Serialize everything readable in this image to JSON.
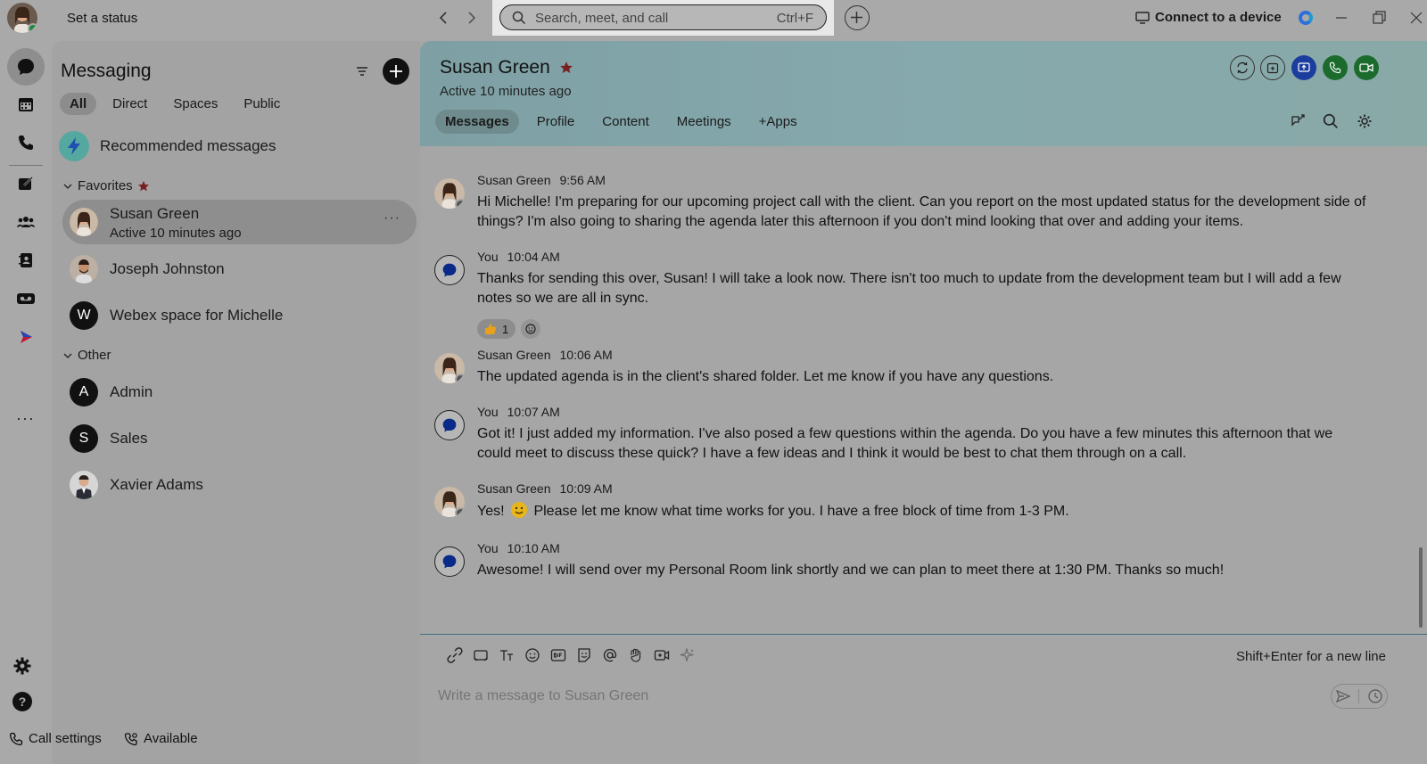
{
  "titlebar": {
    "set_status": "Set a status",
    "search_placeholder": "Search, meet, and call",
    "search_shortcut": "Ctrl+F",
    "connect_device": "Connect to a device"
  },
  "messaging": {
    "title": "Messaging",
    "tabs": [
      "All",
      "Direct",
      "Spaces",
      "Public"
    ],
    "recommended": "Recommended messages",
    "favorites_label": "Favorites",
    "other_label": "Other",
    "favorites": [
      {
        "name": "Susan Green",
        "sub": "Active 10 minutes ago",
        "initial": ""
      },
      {
        "name": "Joseph Johnston",
        "sub": "",
        "initial": ""
      },
      {
        "name": "Webex space for Michelle",
        "sub": "",
        "initial": "W"
      }
    ],
    "others": [
      {
        "name": "Admin",
        "initial": "A"
      },
      {
        "name": "Sales",
        "initial": "S"
      },
      {
        "name": "Xavier Adams",
        "initial": ""
      }
    ]
  },
  "conversation": {
    "name": "Susan Green",
    "status": "Active 10 minutes ago",
    "tabs": [
      "Messages",
      "Profile",
      "Content",
      "Meetings",
      "+Apps"
    ],
    "messages": [
      {
        "sender": "Susan Green",
        "time": "9:56 AM",
        "text": "Hi Michelle! I'm preparing for our upcoming project call with the client. Can you report on the most updated status for the development side of things? I'm also going to sharing the agenda later this afternoon if you don't mind looking that over and adding your items."
      },
      {
        "sender": "You",
        "time": "10:04 AM",
        "text": "Thanks for sending this over, Susan! I will take a look now. There isn't too much to update from the development team but I will add a few notes so we are all in sync.",
        "reaction_count": "1"
      },
      {
        "sender": "Susan Green",
        "time": "10:06 AM",
        "text": "The updated agenda is in the client's shared folder. Let me know if you have any questions."
      },
      {
        "sender": "You",
        "time": "10:07 AM",
        "text": "Got it! I just added my information. I've also posed a few questions within the agenda. Do you have a few minutes this afternoon that we could meet to discuss these quick? I have a few ideas and I think it would be best to chat them through on a call."
      },
      {
        "sender": "Susan Green",
        "time": "10:09 AM",
        "text_before": "Yes!",
        "text_after": "Please let me know what time works for you. I have a free block of time from 1-3 PM."
      },
      {
        "sender": "You",
        "time": "10:10 AM",
        "text": "Awesome! I will send over my Personal Room link shortly and we can plan to meet there at 1:30 PM. Thanks so much!"
      }
    ],
    "composer": {
      "hint": "Shift+Enter for a new line",
      "placeholder": "Write a message to Susan Green"
    }
  },
  "statusbar": {
    "call_settings": "Call settings",
    "available": "Available"
  },
  "colors": {
    "header_teal": "#86a9ad",
    "presence_green": "#1d8a3a",
    "call_green": "#1b6b2c",
    "share_blue": "#1a3d9e",
    "favorite_star": "#7a1f1f"
  }
}
